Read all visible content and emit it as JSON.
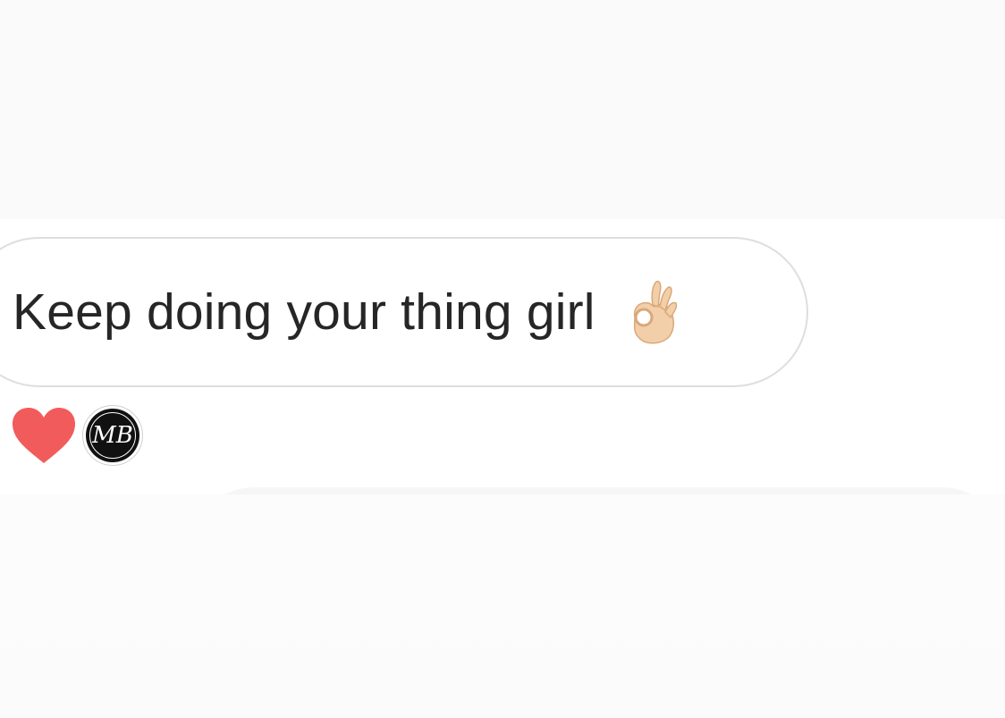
{
  "message": {
    "text": "Keep doing your thing girl",
    "emoji": "ok-hand-icon"
  },
  "reactions": {
    "reaction": "heart-icon",
    "reactor_avatar_monogram": "MB"
  },
  "colors": {
    "heart": "#f25b5b",
    "bubble_border": "#dedede",
    "text": "#262626",
    "top_band": "#fafafa"
  }
}
